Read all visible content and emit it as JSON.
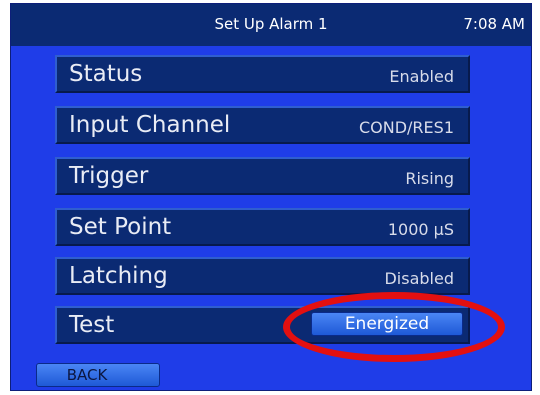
{
  "header": {
    "title": "Set Up Alarm 1",
    "time": "7:08 AM"
  },
  "settings": [
    {
      "label": "Status",
      "value": "Enabled"
    },
    {
      "label": "Input Channel",
      "value": "COND/RES1"
    },
    {
      "label": "Trigger",
      "value": "Rising"
    },
    {
      "label": "Set Point",
      "value": "1000 µS"
    },
    {
      "label": "Latching",
      "value": "Disabled"
    },
    {
      "label": "Test",
      "value": "Energized"
    }
  ],
  "nav": {
    "back_label": "BACK"
  },
  "colors": {
    "screen_background": "#1f3de8",
    "panel": "#0b2a73",
    "button": "#3a74ea",
    "highlight_ring": "#e31010"
  }
}
